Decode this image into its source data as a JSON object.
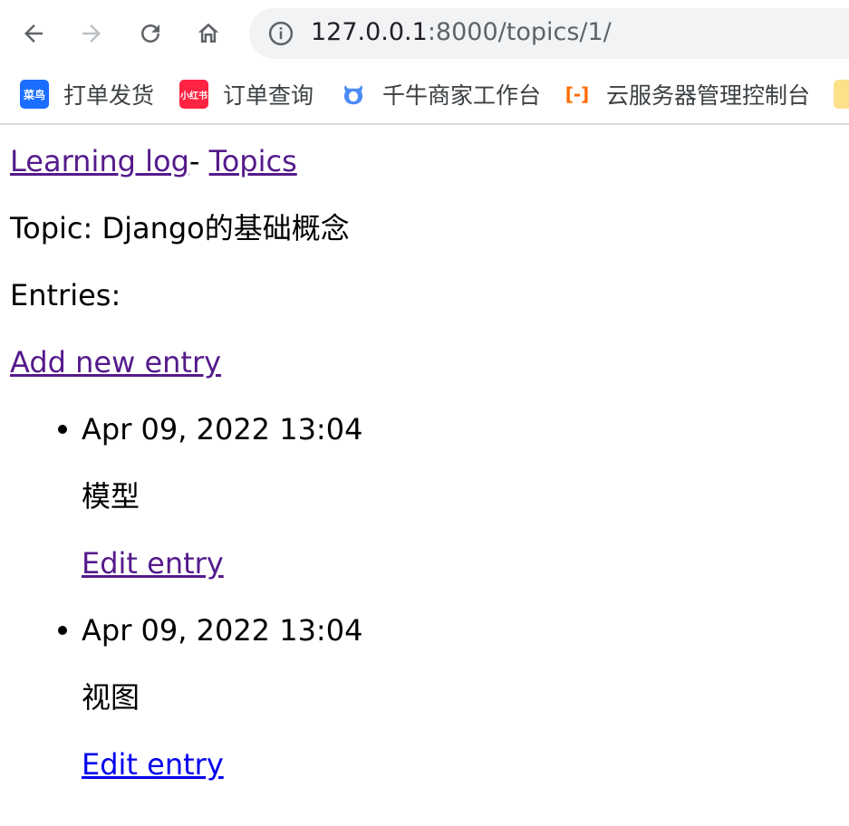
{
  "browser": {
    "url_host": "127.0.0.1",
    "url_rest": ":8000/topics/1/",
    "bookmarks": [
      {
        "label": "打单发货",
        "icon_text": "菜鸟",
        "icon_color": "#1a6dff"
      },
      {
        "label": "订单查询",
        "icon_text": "小红书",
        "icon_color": "#ff2442"
      },
      {
        "label": "千牛商家工作台",
        "icon_text": "",
        "icon_color": "#4c8bf5"
      },
      {
        "label": "云服务器管理控制台",
        "icon_text": "[-]",
        "icon_color": "#ff6a00"
      },
      {
        "label": "",
        "icon_text": "",
        "icon_color": "#fce08a"
      }
    ]
  },
  "page": {
    "nav": {
      "home_link": "Learning log",
      "separator": "- ",
      "topics_link": "Topics"
    },
    "topic_label": "Topic: Django的基础概念",
    "entries_label": "Entries:",
    "add_entry_link": "Add new entry",
    "entries": [
      {
        "date": "Apr 09, 2022 13:04",
        "text": "模型",
        "edit_label": "Edit entry"
      },
      {
        "date": "Apr 09, 2022 13:04",
        "text": "视图",
        "edit_label": "Edit entry"
      }
    ]
  }
}
